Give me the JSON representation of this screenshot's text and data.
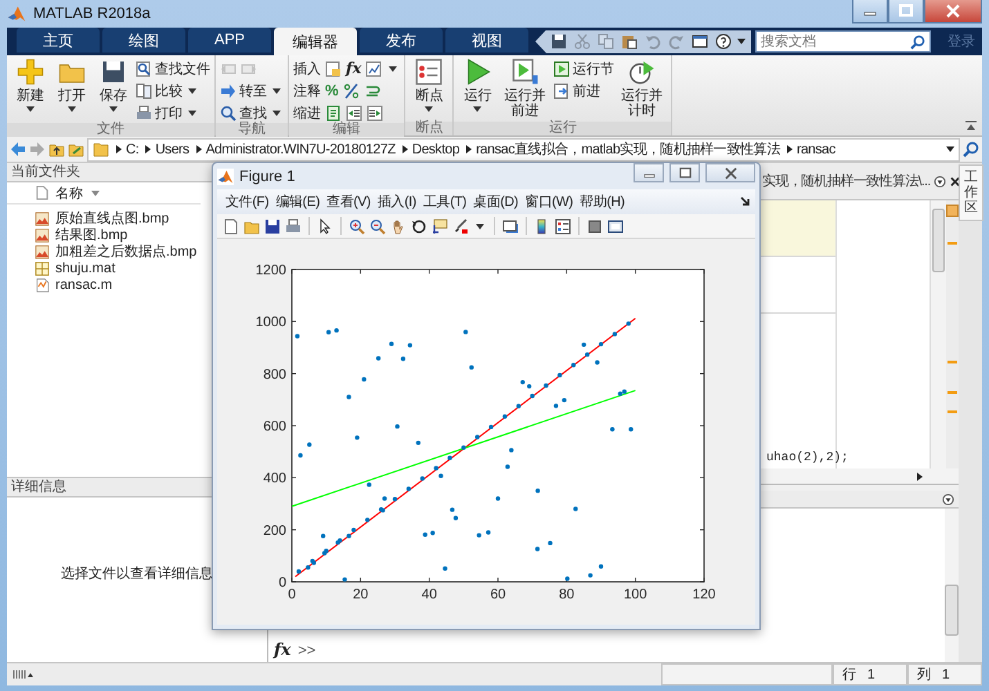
{
  "window": {
    "title": "MATLAB R2018a"
  },
  "tabs": [
    {
      "label": "主页",
      "selected": false
    },
    {
      "label": "绘图",
      "selected": false
    },
    {
      "label": "APP",
      "selected": false
    },
    {
      "label": "编辑器",
      "selected": true
    },
    {
      "label": "发布",
      "selected": false
    },
    {
      "label": "视图",
      "selected": false
    }
  ],
  "quick_access": [
    {
      "kind": "save",
      "disabled": false
    },
    {
      "kind": "cut",
      "disabled": true
    },
    {
      "kind": "copy",
      "disabled": true
    },
    {
      "kind": "paste",
      "disabled": false
    },
    {
      "kind": "undo",
      "disabled": true
    },
    {
      "kind": "redo",
      "disabled": true
    },
    {
      "kind": "window",
      "disabled": false
    },
    {
      "kind": "help",
      "disabled": false
    }
  ],
  "search": {
    "placeholder": "搜索文档"
  },
  "sign_in": "登录",
  "ribbon": {
    "file": {
      "label": "文件",
      "new": "新建",
      "open": "打开",
      "save": "保存",
      "find_files": "查找文件",
      "compare": "比较",
      "print": "打印"
    },
    "navigate": {
      "label": "导航",
      "back": {
        "disabled": true
      },
      "forward": {
        "disabled": true
      },
      "go_to": "转至",
      "find": "查找"
    },
    "edit": {
      "label": "编辑",
      "insert": "插入",
      "comment": "注释",
      "indent": "缩进",
      "fx_symbol": "fx",
      "percent_symbol": "%"
    },
    "breakpoints": {
      "label": "断点",
      "breakpoints": "断点"
    },
    "run": {
      "label": "运行",
      "run": "运行",
      "run_and_advance": "运行并前进",
      "run_section": "运行节",
      "advance": "前进",
      "run_and_time": "运行并计时"
    }
  },
  "address": {
    "path": [
      "C:",
      "Users",
      "Administrator.WIN7U-20180127Z",
      "Desktop",
      "ransac直线拟合，matlab实现，随机抽样一致性算法",
      "ransac"
    ]
  },
  "current_folder": {
    "title": "当前文件夹",
    "column": "名称",
    "files": [
      {
        "name": "原始直线点图.bmp",
        "kind": "image"
      },
      {
        "name": "结果图.bmp",
        "kind": "image"
      },
      {
        "name": "加粗差之后数据点.bmp",
        "kind": "image"
      },
      {
        "name": "shuju.mat",
        "kind": "data"
      },
      {
        "name": "ransac.m",
        "kind": "script"
      }
    ]
  },
  "details": {
    "title": "详细信息",
    "message": "选择文件以查看详细信息"
  },
  "editor": {
    "tab_title": "实现，随机抽样一致性算法\\...",
    "code_fragment": "uhao(2),2);"
  },
  "command_window": {
    "fx_symbol": "fx",
    "prompt": ">>"
  },
  "workspace_tab": "工作区",
  "status_bar": {
    "line_label": "行",
    "line": "1",
    "column_label": "列",
    "column": "1"
  },
  "figure": {
    "title": "Figure 1",
    "menu": [
      "文件(F)",
      "编辑(E)",
      "查看(V)",
      "插入(I)",
      "工具(T)",
      "桌面(D)",
      "窗口(W)",
      "帮助(H)"
    ],
    "chart_data": {
      "type": "scatter",
      "xlim": [
        0,
        120
      ],
      "ylim": [
        0,
        1200
      ],
      "xticks": [
        0,
        20,
        40,
        60,
        80,
        100,
        120
      ],
      "yticks": [
        0,
        200,
        400,
        600,
        800,
        1000,
        1200
      ],
      "series": [
        {
          "type": "scatter",
          "color": "#0072bd",
          "x": [
            1.6,
            2.5,
            5.1,
            4.7,
            6.4,
            9.1,
            9.5,
            10.7,
            13,
            13.4,
            15.4,
            16.6,
            16.6,
            19,
            21,
            22.5,
            25.2,
            27,
            26.5,
            29,
            30.7,
            32.4,
            34.4,
            36.8,
            38.8,
            41,
            43.4,
            44.6,
            46.7,
            47.7,
            50.6,
            52.3,
            54.5,
            57.2,
            60,
            62.8,
            63.9,
            67.2,
            69.1,
            71.5,
            71.6,
            75.2,
            76.9,
            79.3,
            80.2,
            82.6,
            85,
            86.9,
            88.9,
            90,
            93.3,
            95.6,
            96.8,
            98.7,
            2,
            6,
            10,
            14,
            18,
            22,
            26,
            30,
            34,
            38,
            42,
            46,
            50,
            54,
            58,
            62,
            66,
            70,
            74,
            78,
            82,
            86,
            90,
            94,
            98
          ],
          "values": [
            944,
            486,
            527,
            55,
            73,
            176,
            110,
            959,
            966,
            151,
            9,
            710,
            176,
            554,
            778,
            373,
            859,
            320,
            275,
            914,
            597,
            857,
            909,
            534,
            181,
            188,
            407,
            51,
            277,
            245,
            960,
            824,
            179,
            190,
            320,
            442,
            506,
            767,
            751,
            126,
            350,
            149,
            676,
            698,
            12,
            280,
            911,
            25,
            843,
            59,
            586,
            723,
            731,
            586,
            40,
            80,
            119,
            159,
            199,
            238,
            278,
            318,
            357,
            397,
            437,
            476,
            516,
            556,
            595,
            635,
            675,
            714,
            754,
            794,
            833,
            873,
            913,
            952,
            992
          ]
        },
        {
          "type": "line",
          "color": "#ff0000",
          "x": [
            1,
            100
          ],
          "values": [
            20,
            1012
          ]
        },
        {
          "type": "line",
          "color": "#00ff00",
          "x": [
            0,
            100
          ],
          "values": [
            290,
            735
          ]
        }
      ]
    }
  }
}
